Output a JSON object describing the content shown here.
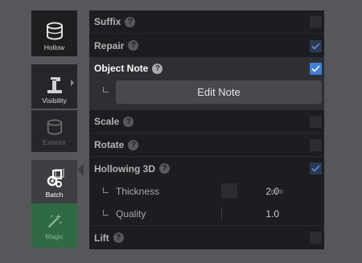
{
  "sidebar": {
    "hollow_label": "Hollow",
    "visibility_label": "Visibility",
    "exterior_label": "Exterior",
    "batch_label": "Batch",
    "magic_label": "Magic"
  },
  "panel": {
    "suffix": "Suffix",
    "repair": "Repair",
    "object_note": "Object Note",
    "edit_note": "Edit Note",
    "scale": "Scale",
    "rotate": "Rotate",
    "hollowing": "Hollowing 3D",
    "thickness_label": "Thickness",
    "thickness_value": "2.0",
    "thickness_unit": "mm",
    "quality_label": "Quality",
    "quality_value": "1.0",
    "lift": "Lift",
    "help_glyph": "?"
  },
  "checks": {
    "suffix": false,
    "repair": true,
    "object_note": true,
    "scale": false,
    "rotate": false,
    "hollowing": true,
    "lift": false
  },
  "colors": {
    "accent": "#3f7fd9",
    "magic": "#2f6a45",
    "panel": "#1c1d20"
  }
}
